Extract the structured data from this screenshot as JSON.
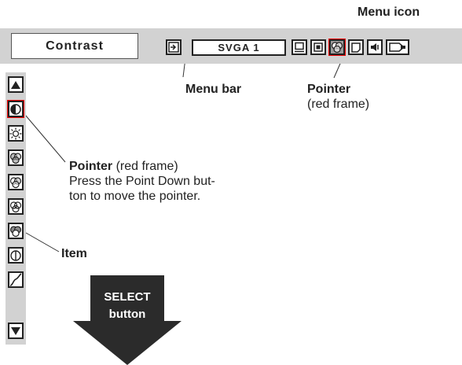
{
  "menu_icon_label": "Menu icon",
  "item_name": "Contrast",
  "source_name": "SVGA 1",
  "menu_bar_label": "Menu bar",
  "pointer_top": {
    "bold": "Pointer",
    "note": "(red frame)"
  },
  "pointer_side": {
    "bold": "Pointer",
    "note": "(red frame)",
    "line2": "Press the Point Down but-",
    "line3": "ton to move the pointer."
  },
  "item_label": "Item",
  "select_button": {
    "line1": "SELECT",
    "line2": "button"
  },
  "colors": {
    "bar": "#d2d2d2",
    "frame": "#222222",
    "pointer": "#e00000",
    "arrow": "#2b2b2b"
  }
}
